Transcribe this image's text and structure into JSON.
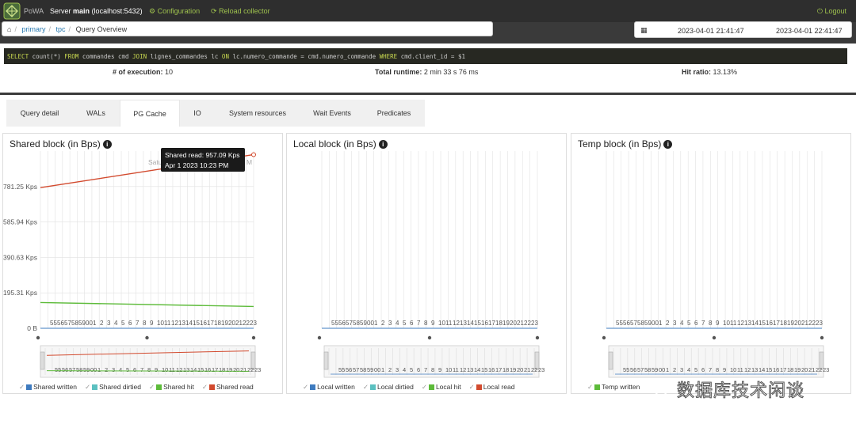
{
  "app": {
    "brand": "PoWA",
    "server_label": "Server",
    "server_name": "main",
    "server_host": "(localhost:5432)",
    "configuration": "Configuration",
    "reload": "Reload collector",
    "logout": "Logout"
  },
  "breadcrumb": {
    "items": [
      "primary",
      "tpc",
      "Query Overview"
    ]
  },
  "daterange": {
    "from": "2023-04-01 21:41:47",
    "to": "2023-04-01 22:41:47"
  },
  "query": {
    "sql": "SELECT count(*) FROM commandes cmd JOIN lignes_commandes lc ON lc.numero_commande = cmd.numero_commande WHERE cmd.client_id = $1"
  },
  "stats": {
    "executions_label": "# of execution:",
    "executions": "10",
    "runtime_label": "Total runtime:",
    "runtime": "2 min 33 s 76 ms",
    "hitratio_label": "Hit ratio:",
    "hitratio": "13.13%"
  },
  "tabs": [
    "Query detail",
    "WALs",
    "PG Cache",
    "IO",
    "System resources",
    "Wait Events",
    "Predicates"
  ],
  "active_tab": "PG Cache",
  "x_ticks": [
    "55",
    "56",
    "57",
    "58",
    "59",
    "00",
    "1",
    "2",
    "3",
    "4",
    "5",
    "6",
    "7",
    "8",
    "9",
    "10",
    "11",
    "12",
    "13",
    "14",
    "15",
    "16",
    "17",
    "18",
    "19",
    "20",
    "21",
    "22",
    "23"
  ],
  "tooltip": {
    "line1": "Shared read: 957.09 Kps",
    "line2": "Apr 1 2023 10:23 PM",
    "behind_text": "Satu",
    "behind_tail": "M"
  },
  "colors": {
    "written": "#3e7bbf",
    "dirtied": "#5bc0c0",
    "hit": "#5dbb3a",
    "read": "#d24a2e"
  },
  "chart_data": [
    {
      "type": "line",
      "title": "Shared block (in Bps)",
      "y_ticks": [
        "0 B",
        "195.31 Kps",
        "390.63 Kps",
        "585.94 Kps",
        "781.25 Kps"
      ],
      "ylim_kbps": [
        0,
        976.56
      ],
      "x": [
        "21:55",
        "22:23"
      ],
      "series": [
        {
          "name": "Shared written",
          "values": [
            0,
            0
          ]
        },
        {
          "name": "Shared dirtied",
          "values": [
            0,
            0
          ]
        },
        {
          "name": "Shared hit",
          "values": [
            142,
            120
          ]
        },
        {
          "name": "Shared read",
          "values": [
            775,
            957.09
          ]
        }
      ]
    },
    {
      "type": "line",
      "title": "Local block (in Bps)",
      "x": [
        "21:55",
        "22:23"
      ],
      "series": [
        {
          "name": "Local written",
          "values": [
            0,
            0
          ]
        },
        {
          "name": "Local dirtied",
          "values": [
            0,
            0
          ]
        },
        {
          "name": "Local hit",
          "values": [
            0,
            0
          ]
        },
        {
          "name": "Local read",
          "values": [
            0,
            0
          ]
        }
      ]
    },
    {
      "type": "line",
      "title": "Temp block (in Bps)",
      "x": [
        "21:55",
        "22:23"
      ],
      "series": [
        {
          "name": "Temp written",
          "values": [
            0,
            0
          ]
        }
      ]
    }
  ],
  "legends": [
    [
      {
        "label": "Shared written",
        "color": "#3e7bbf"
      },
      {
        "label": "Shared dirtied",
        "color": "#5bc0c0"
      },
      {
        "label": "Shared hit",
        "color": "#5dbb3a"
      },
      {
        "label": "Shared read",
        "color": "#d24a2e"
      }
    ],
    [
      {
        "label": "Local written",
        "color": "#3e7bbf"
      },
      {
        "label": "Local dirtied",
        "color": "#5bc0c0"
      },
      {
        "label": "Local hit",
        "color": "#5dbb3a"
      },
      {
        "label": "Local read",
        "color": "#d24a2e"
      }
    ],
    [
      {
        "label": "Temp written",
        "color": "#5dbb3a"
      }
    ]
  ],
  "watermark": "数据库技术闲谈"
}
